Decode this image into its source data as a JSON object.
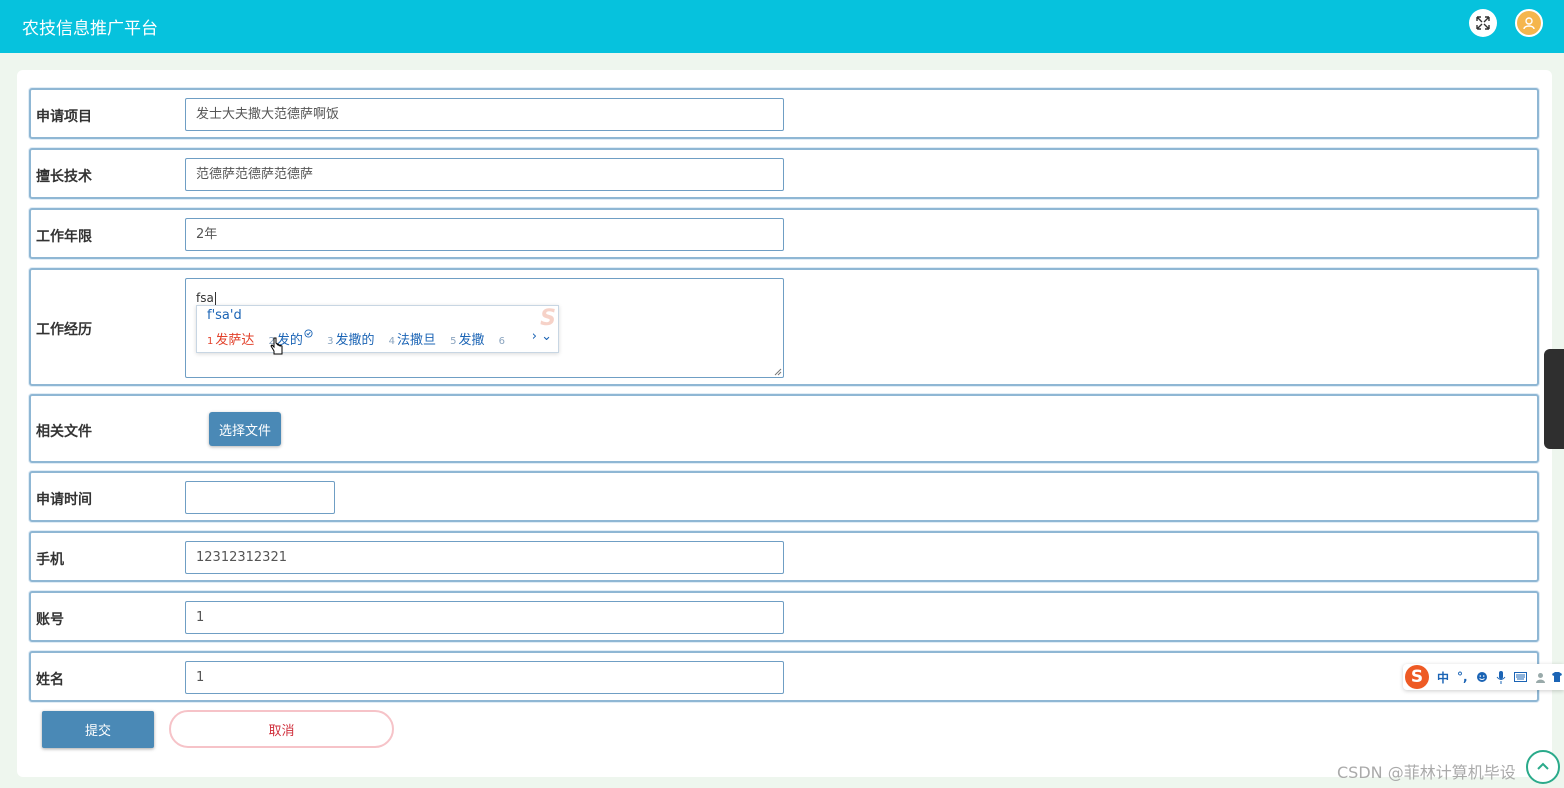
{
  "header": {
    "title": "农技信息推广平台",
    "fullscreen_icon": "expand-icon",
    "avatar_icon": "user-avatar-icon"
  },
  "form": {
    "project": {
      "label": "申请项目",
      "value": "发士大夫撒大范德萨啊饭"
    },
    "skill": {
      "label": "擅长技术",
      "value": "范德萨范德萨范德萨"
    },
    "years": {
      "label": "工作年限",
      "value": "2年"
    },
    "experience": {
      "label": "工作经历",
      "value": "fsa"
    },
    "file": {
      "label": "相关文件",
      "button": "选择文件"
    },
    "apply_time": {
      "label": "申请时间",
      "value": ""
    },
    "phone": {
      "label": "手机",
      "value": "12312312321"
    },
    "account": {
      "label": "账号",
      "value": "1"
    },
    "name": {
      "label": "姓名",
      "value": "1"
    }
  },
  "ime_popup": {
    "composition": "f'sa'd",
    "candidates": [
      {
        "num": "1",
        "text": "发萨达"
      },
      {
        "num": "2",
        "text": "发的"
      },
      {
        "num": "3",
        "text": "发撒的"
      },
      {
        "num": "4",
        "text": "法撒旦"
      },
      {
        "num": "5",
        "text": "发撒"
      }
    ],
    "more_num": "6",
    "nav": "› ⌄"
  },
  "ime_toolbar": {
    "logo": "S",
    "mode": "中",
    "punct": "°,"
  },
  "actions": {
    "submit": "提交",
    "cancel": "取消"
  },
  "watermark": "CSDN @菲林计算机毕设",
  "colors": {
    "header": "#06c2dd",
    "primary_button": "#4a89b6",
    "cancel_text": "#d0303d"
  }
}
